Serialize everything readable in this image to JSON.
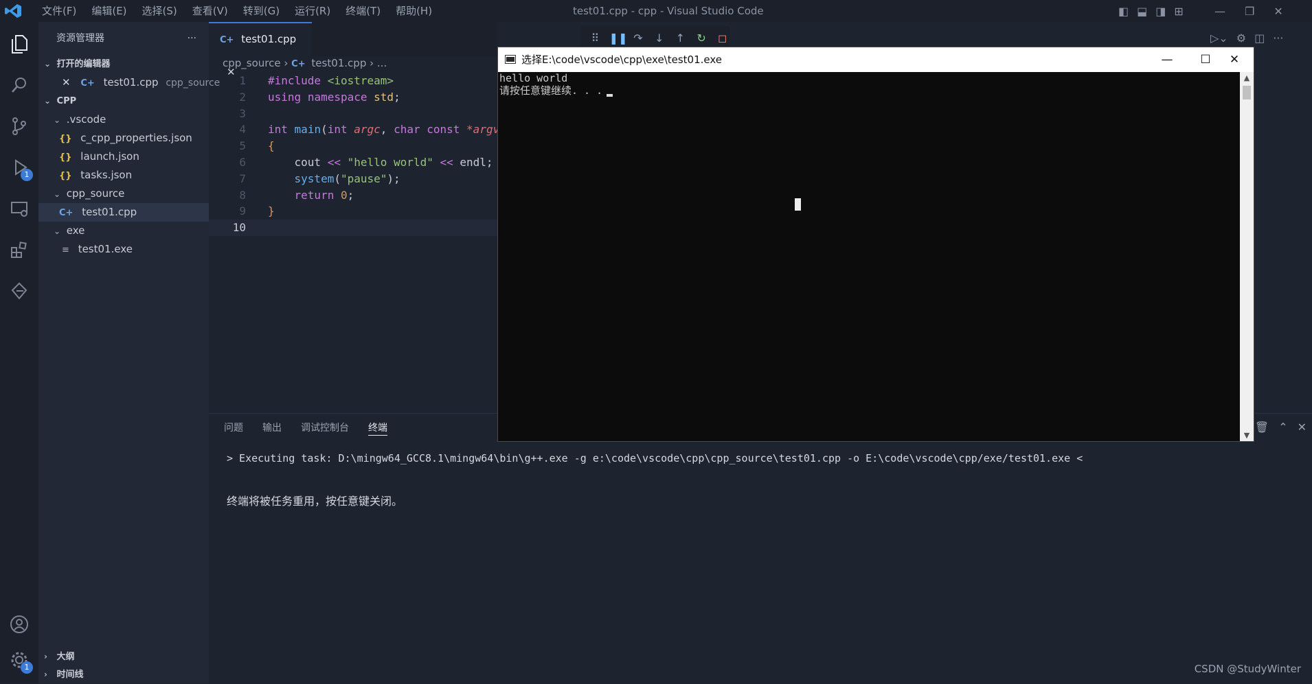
{
  "titlebar": {
    "menu": [
      "文件(F)",
      "编辑(E)",
      "选择(S)",
      "查看(V)",
      "转到(G)",
      "运行(R)",
      "终端(T)",
      "帮助(H)"
    ],
    "window_title": "test01.cpp - cpp - Visual Studio Code"
  },
  "activity": {
    "debug_badge": "1",
    "settings_badge": "1"
  },
  "sidebar": {
    "header": "资源管理器",
    "more": "···",
    "open_editors_label": "打开的编辑器",
    "open_editor": {
      "name": "test01.cpp",
      "folder": "cpp_source"
    },
    "workspace_label": "CPP",
    "tree": [
      {
        "name": ".vscode",
        "type": "folder"
      },
      {
        "name": "c_cpp_properties.json",
        "type": "json"
      },
      {
        "name": "launch.json",
        "type": "json"
      },
      {
        "name": "tasks.json",
        "type": "json"
      },
      {
        "name": "cpp_source",
        "type": "folder"
      },
      {
        "name": "test01.cpp",
        "type": "cpp"
      },
      {
        "name": "exe",
        "type": "folder"
      },
      {
        "name": "test01.exe",
        "type": "exe"
      }
    ],
    "outline_label": "大纲",
    "timeline_label": "时间线"
  },
  "editor": {
    "tab_label": "test01.cpp",
    "breadcrumb": {
      "folder": "cpp_source",
      "file": "test01.cpp",
      "more": "..."
    },
    "line_numbers": [
      "1",
      "2",
      "3",
      "4",
      "5",
      "6",
      "7",
      "8",
      "9",
      "10"
    ]
  },
  "panel": {
    "tabs": [
      "问题",
      "输出",
      "调试控制台",
      "终端"
    ],
    "terminal_command": "> Executing task: D:\\mingw64_GCC8.1\\mingw64\\bin\\g++.exe -g e:\\code\\vscode\\cpp\\cpp_source\\test01.cpp -o E:\\code\\vscode\\cpp/exe/test01.exe <",
    "terminal_message": "终端将被任务重用，按任意键关闭。"
  },
  "console": {
    "title": "选择E:\\code\\vscode\\cpp\\exe\\test01.exe",
    "line1": "hello world",
    "line2": "请按任意键继续. . ."
  },
  "watermark": "CSDN @StudyWinter"
}
